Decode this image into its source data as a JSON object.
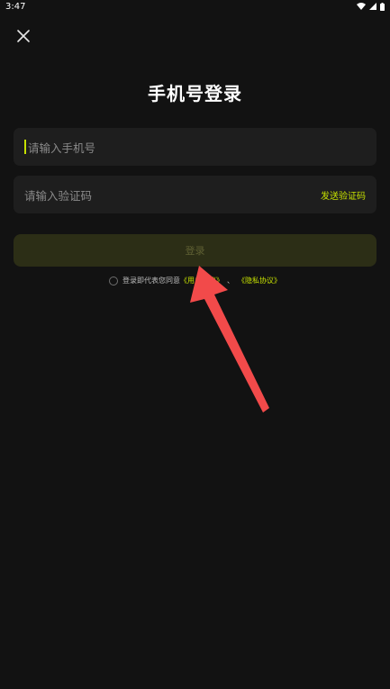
{
  "status_bar": {
    "time": "3:47"
  },
  "page": {
    "title": "手机号登录"
  },
  "phone_field": {
    "placeholder": "请输入手机号"
  },
  "code_field": {
    "placeholder": "请输入验证码",
    "send_code_label": "发送验证码"
  },
  "login_button": {
    "label": "登录"
  },
  "agreement": {
    "prefix": "登录即代表您同意",
    "user_agreement": "《用户协议》",
    "separator": "、",
    "privacy_policy": "《隐私协议》"
  },
  "colors": {
    "background": "#121212",
    "field_bg": "#1e1e1e",
    "accent": "#c6e000",
    "login_button_bg": "#2c2e16",
    "arrow": "#f24a4a"
  },
  "icons": [
    "close-icon",
    "wifi-icon",
    "signal-icon",
    "battery-icon",
    "red-arrow-annotation"
  ]
}
